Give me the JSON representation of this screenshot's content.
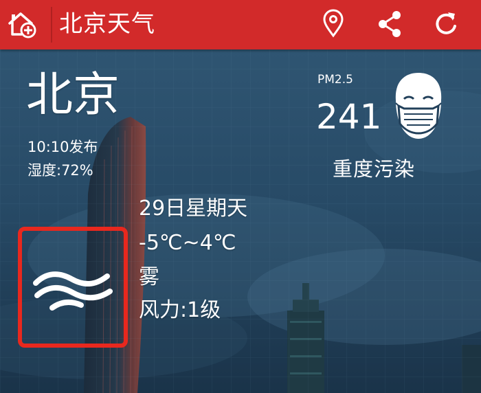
{
  "header": {
    "title": "北京天气",
    "home_icon": "home-add-icon",
    "location_icon": "location-pin-icon",
    "share_icon": "share-icon",
    "refresh_icon": "refresh-icon",
    "bar_color": "#d22a2a"
  },
  "weather": {
    "city": "北京",
    "publish_time": "10:10发布",
    "humidity": "湿度:72%",
    "pm_label": "PM2.5",
    "pm_value": "241",
    "pollution_level": "重度污染",
    "mask_icon": "face-mask-icon",
    "date": "29日星期天",
    "temperature": "-5℃~4℃",
    "condition": "雾",
    "wind": "风力:1级",
    "condition_icon": "fog-icon",
    "highlight_color": "#e8281e"
  }
}
